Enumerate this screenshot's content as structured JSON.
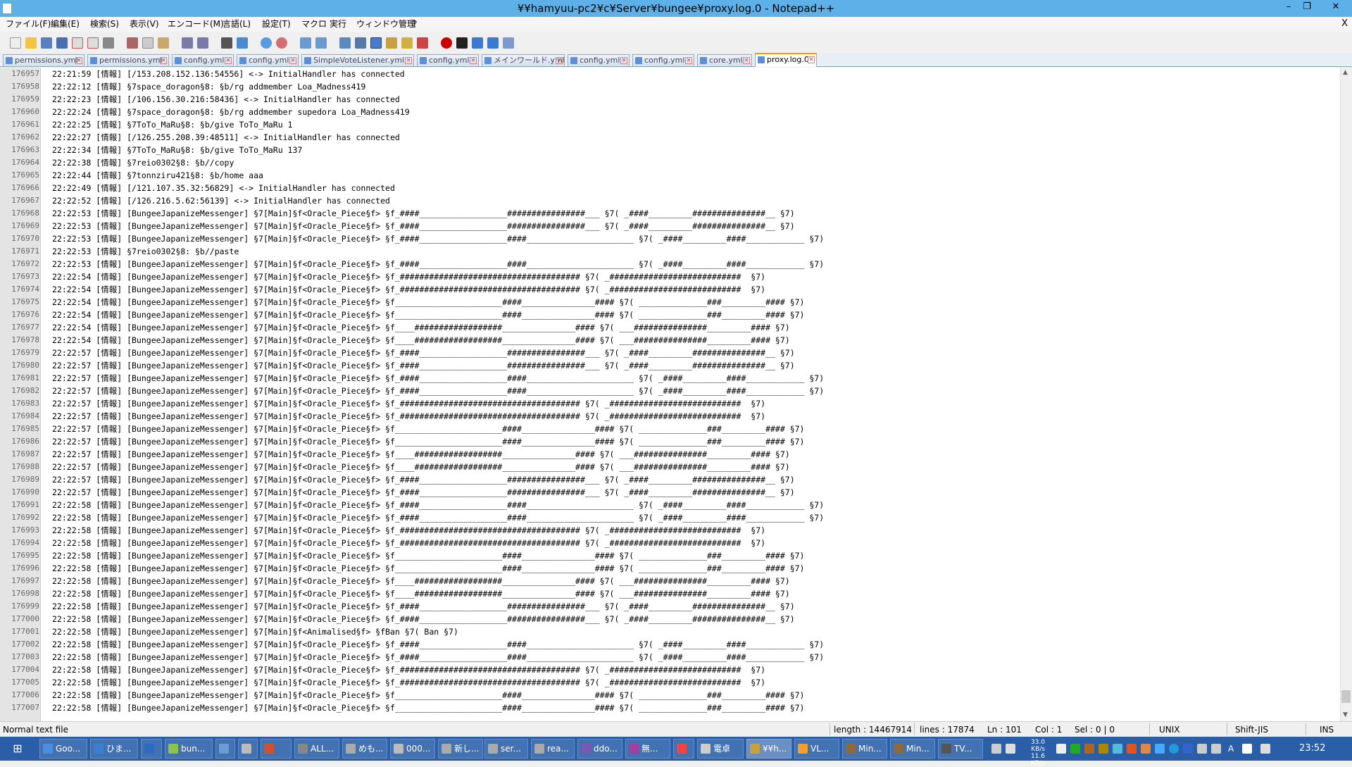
{
  "window": {
    "title": "¥¥hamyuu-pc2¥c¥Server¥bungee¥proxy.log.0 - Notepad++",
    "min": "–",
    "max": "❐",
    "close": "✕"
  },
  "menu": {
    "items": [
      "ファイル(F)",
      "編集(E)",
      "検索(S)",
      "表示(V)",
      "エンコード(M)",
      "言語(L)",
      "設定(T)",
      "マクロ",
      "実行",
      "ウィンドウ管理",
      "?"
    ],
    "close": "X"
  },
  "tabs": [
    {
      "label": "permissions.yml"
    },
    {
      "label": "permissions.yml"
    },
    {
      "label": "config.yml"
    },
    {
      "label": "config.yml"
    },
    {
      "label": "SimpleVoteListener.yml"
    },
    {
      "label": "config.yml"
    },
    {
      "label": "メインワールド.yml"
    },
    {
      "label": "config.yml"
    },
    {
      "label": "config.yml"
    },
    {
      "label": "core.yml"
    },
    {
      "label": "proxy.log.0"
    }
  ],
  "lines": [
    {
      "n": "176957",
      "text": "22:21:59 [情報] [/153.208.152.136:54556] <-> InitialHandler has connected"
    },
    {
      "n": "176958",
      "text": "22:22:12 [情報] §7space_doragon§8: §b/rg addmember Loa_Madness419"
    },
    {
      "n": "176959",
      "text": "22:22:23 [情報] [/106.156.30.216:58436] <-> InitialHandler has connected"
    },
    {
      "n": "176960",
      "text": "22:22:24 [情報] §7space_doragon§8: §b/rg addmember supedora Loa_Madness419"
    },
    {
      "n": "176961",
      "text": "22:22:25 [情報] §7ToTo_MaRu§8: §b/give ToTo_MaRu 1"
    },
    {
      "n": "176962",
      "text": "22:22:27 [情報] [/126.255.208.39:48511] <-> InitialHandler has connected"
    },
    {
      "n": "176963",
      "text": "22:22:34 [情報] §7ToTo_MaRu§8: §b/give ToTo_MaRu 137"
    },
    {
      "n": "176964",
      "text": "22:22:38 [情報] §7reio0302§8: §b//copy"
    },
    {
      "n": "176965",
      "text": "22:22:44 [情報] §7tonnziru421§8: §b/home aaa"
    },
    {
      "n": "176966",
      "text": "22:22:49 [情報] [/121.107.35.32:56829] <-> InitialHandler has connected"
    },
    {
      "n": "176967",
      "text": "22:22:52 [情報] [/126.216.5.62:56139] <-> InitialHandler has connected"
    },
    {
      "n": "176968",
      "text": "22:22:53 [情報] [BungeeJapanizeMessenger] §7[Main]§f<Oracle_Piece§f> §f_####__________________################___ §7( _####_________###############__ §7)"
    },
    {
      "n": "176969",
      "text": "22:22:53 [情報] [BungeeJapanizeMessenger] §7[Main]§f<Oracle_Piece§f> §f_####__________________################___ §7( _####_________###############__ §7)"
    },
    {
      "n": "176970",
      "text": "22:22:53 [情報] [BungeeJapanizeMessenger] §7[Main]§f<Oracle_Piece§f> §f_####__________________####______________________ §7( _####_________####____________ §7)"
    },
    {
      "n": "176971",
      "text": "22:22:53 [情報] §7reio0302§8: §b//paste"
    },
    {
      "n": "176972",
      "text": "22:22:53 [情報] [BungeeJapanizeMessenger] §7[Main]§f<Oracle_Piece§f> §f_####__________________####______________________ §7( _####_________####____________ §7)"
    },
    {
      "n": "176973",
      "text": "22:22:54 [情報] [BungeeJapanizeMessenger] §7[Main]§f<Oracle_Piece§f> §f_##################################### §7( _###########################  §7)"
    },
    {
      "n": "176974",
      "text": "22:22:54 [情報] [BungeeJapanizeMessenger] §7[Main]§f<Oracle_Piece§f> §f_##################################### §7( _###########################  §7)"
    },
    {
      "n": "176975",
      "text": "22:22:54 [情報] [BungeeJapanizeMessenger] §7[Main]§f<Oracle_Piece§f> §f______________________####_______________#### §7( ______________###_________#### §7)"
    },
    {
      "n": "176976",
      "text": "22:22:54 [情報] [BungeeJapanizeMessenger] §7[Main]§f<Oracle_Piece§f> §f______________________####_______________#### §7( ______________###_________#### §7)"
    },
    {
      "n": "176977",
      "text": "22:22:54 [情報] [BungeeJapanizeMessenger] §7[Main]§f<Oracle_Piece§f> §f____##################_______________#### §7( ___###############_________#### §7)"
    },
    {
      "n": "176978",
      "text": "22:22:54 [情報] [BungeeJapanizeMessenger] §7[Main]§f<Oracle_Piece§f> §f____##################_______________#### §7( ___###############_________#### §7)"
    },
    {
      "n": "176979",
      "text": "22:22:57 [情報] [BungeeJapanizeMessenger] §7[Main]§f<Oracle_Piece§f> §f_####__________________################___ §7( _####_________###############__ §7)"
    },
    {
      "n": "176980",
      "text": "22:22:57 [情報] [BungeeJapanizeMessenger] §7[Main]§f<Oracle_Piece§f> §f_####__________________################___ §7( _####_________###############__ §7)"
    },
    {
      "n": "176981",
      "text": "22:22:57 [情報] [BungeeJapanizeMessenger] §7[Main]§f<Oracle_Piece§f> §f_####__________________####______________________ §7( _####_________####____________ §7)"
    },
    {
      "n": "176982",
      "text": "22:22:57 [情報] [BungeeJapanizeMessenger] §7[Main]§f<Oracle_Piece§f> §f_####__________________####______________________ §7( _####_________####____________ §7)"
    },
    {
      "n": "176983",
      "text": "22:22:57 [情報] [BungeeJapanizeMessenger] §7[Main]§f<Oracle_Piece§f> §f_##################################### §7( _###########################  §7)"
    },
    {
      "n": "176984",
      "text": "22:22:57 [情報] [BungeeJapanizeMessenger] §7[Main]§f<Oracle_Piece§f> §f_##################################### §7( _###########################  §7)"
    },
    {
      "n": "176985",
      "text": "22:22:57 [情報] [BungeeJapanizeMessenger] §7[Main]§f<Oracle_Piece§f> §f______________________####_______________#### §7( ______________###_________#### §7)"
    },
    {
      "n": "176986",
      "text": "22:22:57 [情報] [BungeeJapanizeMessenger] §7[Main]§f<Oracle_Piece§f> §f______________________####_______________#### §7( ______________###_________#### §7)"
    },
    {
      "n": "176987",
      "text": "22:22:57 [情報] [BungeeJapanizeMessenger] §7[Main]§f<Oracle_Piece§f> §f____##################_______________#### §7( ___###############_________#### §7)"
    },
    {
      "n": "176988",
      "text": "22:22:57 [情報] [BungeeJapanizeMessenger] §7[Main]§f<Oracle_Piece§f> §f____##################_______________#### §7( ___###############_________#### §7)"
    },
    {
      "n": "176989",
      "text": "22:22:57 [情報] [BungeeJapanizeMessenger] §7[Main]§f<Oracle_Piece§f> §f_####__________________################___ §7( _####_________###############__ §7)"
    },
    {
      "n": "176990",
      "text": "22:22:57 [情報] [BungeeJapanizeMessenger] §7[Main]§f<Oracle_Piece§f> §f_####__________________################___ §7( _####_________###############__ §7)"
    },
    {
      "n": "176991",
      "text": "22:22:58 [情報] [BungeeJapanizeMessenger] §7[Main]§f<Oracle_Piece§f> §f_####__________________####______________________ §7( _####_________####____________ §7)"
    },
    {
      "n": "176992",
      "text": "22:22:58 [情報] [BungeeJapanizeMessenger] §7[Main]§f<Oracle_Piece§f> §f_####__________________####______________________ §7( _####_________####____________ §7)"
    },
    {
      "n": "176993",
      "text": "22:22:58 [情報] [BungeeJapanizeMessenger] §7[Main]§f<Oracle_Piece§f> §f_##################################### §7( _###########################  §7)"
    },
    {
      "n": "176994",
      "text": "22:22:58 [情報] [BungeeJapanizeMessenger] §7[Main]§f<Oracle_Piece§f> §f_##################################### §7( _###########################  §7)"
    },
    {
      "n": "176995",
      "text": "22:22:58 [情報] [BungeeJapanizeMessenger] §7[Main]§f<Oracle_Piece§f> §f______________________####_______________#### §7( ______________###_________#### §7)"
    },
    {
      "n": "176996",
      "text": "22:22:58 [情報] [BungeeJapanizeMessenger] §7[Main]§f<Oracle_Piece§f> §f______________________####_______________#### §7( ______________###_________#### §7)"
    },
    {
      "n": "176997",
      "text": "22:22:58 [情報] [BungeeJapanizeMessenger] §7[Main]§f<Oracle_Piece§f> §f____##################_______________#### §7( ___###############_________#### §7)"
    },
    {
      "n": "176998",
      "text": "22:22:58 [情報] [BungeeJapanizeMessenger] §7[Main]§f<Oracle_Piece§f> §f____##################_______________#### §7( ___###############_________#### §7)"
    },
    {
      "n": "176999",
      "text": "22:22:58 [情報] [BungeeJapanizeMessenger] §7[Main]§f<Oracle_Piece§f> §f_####__________________################___ §7( _####_________###############__ §7)"
    },
    {
      "n": "177000",
      "text": "22:22:58 [情報] [BungeeJapanizeMessenger] §7[Main]§f<Oracle_Piece§f> §f_####__________________################___ §7( _####_________###############__ §7)"
    },
    {
      "n": "177001",
      "text": "22:22:58 [情報] [BungeeJapanizeMessenger] §7[Main]§f<Animalised§f> §fBan §7( Ban §7)"
    },
    {
      "n": "177002",
      "text": "22:22:58 [情報] [BungeeJapanizeMessenger] §7[Main]§f<Oracle_Piece§f> §f_####__________________####______________________ §7( _####_________####____________ §7)"
    },
    {
      "n": "177003",
      "text": "22:22:58 [情報] [BungeeJapanizeMessenger] §7[Main]§f<Oracle_Piece§f> §f_####__________________####______________________ §7( _####_________####____________ §7)"
    },
    {
      "n": "177004",
      "text": "22:22:58 [情報] [BungeeJapanizeMessenger] §7[Main]§f<Oracle_Piece§f> §f_##################################### §7( _###########################  §7)"
    },
    {
      "n": "177005",
      "text": "22:22:58 [情報] [BungeeJapanizeMessenger] §7[Main]§f<Oracle_Piece§f> §f_##################################### §7( _###########################  §7)"
    },
    {
      "n": "177006",
      "text": "22:22:58 [情報] [BungeeJapanizeMessenger] §7[Main]§f<Oracle_Piece§f> §f______________________####_______________#### §7( ______________###_________#### §7)"
    },
    {
      "n": "177007",
      "text": "22:22:58 [情報] [BungeeJapanizeMessenger] §7[Main]§f<Oracle_Piece§f> §f______________________####_______________#### §7( ______________###_________#### §7)"
    }
  ],
  "status": {
    "type": "Normal text file",
    "length": "length : 14467914",
    "lines": "lines : 17874",
    "ln": "Ln : 101",
    "col": "Col : 1",
    "sel": "Sel : 0 | 0",
    "eol": "UNIX",
    "encoding": "Shift-JIS",
    "mode": "INS"
  },
  "taskbar": {
    "items": [
      "Goo...",
      "ひま...",
      "",
      "bun...",
      "",
      "",
      "",
      "ALL...",
      "めも...",
      "000...",
      "新し...",
      "ser...",
      "rea...",
      "ddo...",
      "無...",
      "",
      "電卓",
      "¥¥h...",
      "VL...",
      "Min...",
      "Min...",
      "TV..."
    ],
    "net_up": "33.0 KB/s",
    "net_down": "11.6 KB/s",
    "clock": "23:52"
  }
}
